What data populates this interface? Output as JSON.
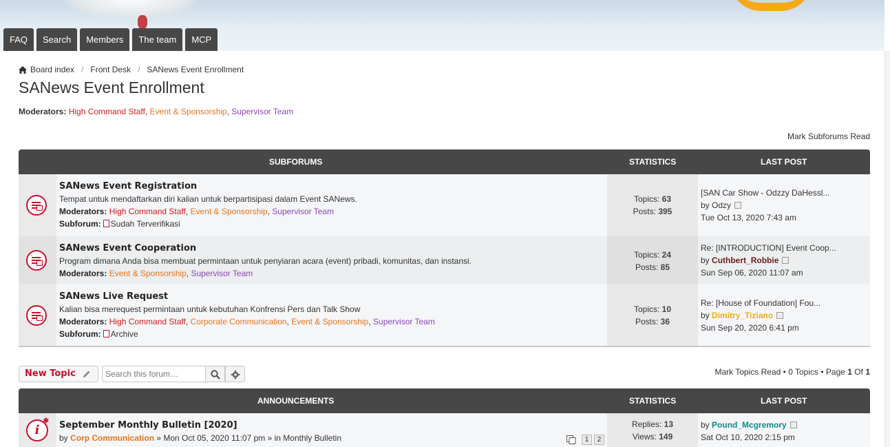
{
  "nav": [
    {
      "label": "FAQ"
    },
    {
      "label": "Search"
    },
    {
      "label": "Members"
    },
    {
      "label": "The team"
    },
    {
      "label": "MCP"
    }
  ],
  "breadcrumb": {
    "home": "Board index",
    "sep": "/",
    "items": [
      "Front Desk",
      "SANews Event Enrollment"
    ]
  },
  "page_title": "SANews Event Enrollment",
  "moderators": {
    "label": "Moderators:",
    "list": [
      "High Command Staff",
      "Event & Sponsorship",
      "Supervisor Team"
    ]
  },
  "mark_subforums_read": "Mark Subforums Read",
  "subforum_table": {
    "head_title": "SUBFORUMS",
    "head_stats": "STATISTICS",
    "head_last": "LAST POST",
    "rows": [
      {
        "title": "SANews Event Registration",
        "desc": "Tempat untuk mendaftarkan diri kalian untuk berpartisipasi dalam Event SANews.",
        "mod_label": "Moderators:",
        "mods": [
          "High Command Staff",
          "Event & Sponsorship",
          "Supervisor Team"
        ],
        "sub_label": "Subforum:",
        "subforum": "Sudah Terverifikasi",
        "topics_label": "Topics:",
        "topics": "63",
        "posts_label": "Posts:",
        "posts": "395",
        "last_title": "[SAN Car Show - Odzzy DaHessl...",
        "last_by": "by",
        "last_user": "Odzy",
        "last_date": "Tue Oct 13, 2020 7:43 am"
      },
      {
        "title": "SANews Event Cooperation",
        "desc": "Program dimana Anda bisa membuat permintaan untuk penyiaran acara (event) pribadi, komunitas, dan instansi.",
        "mod_label": "Moderators:",
        "mods": [
          "Event & Sponsorship",
          "Supervisor Team"
        ],
        "topics_label": "Topics:",
        "topics": "24",
        "posts_label": "Posts:",
        "posts": "85",
        "last_title": "Re: [INTRODUCTION] Event Coop...",
        "last_by": "by",
        "last_user": "Cuthbert_Robbie",
        "last_date": "Sun Sep 06, 2020 11:07 am"
      },
      {
        "title": "SANews Live Request",
        "desc": "Kalian bisa merequest permintaan untuk kebutuhan Konfrensi Pers dan Talk Show",
        "mod_label": "Moderators:",
        "mods": [
          "High Command Staff",
          "Corporate Communication",
          "Event & Sponsorship",
          "Supervisor Team"
        ],
        "sub_label": "Subforum:",
        "subforum": "Archive",
        "topics_label": "Topics:",
        "topics": "10",
        "posts_label": "Posts:",
        "posts": "36",
        "last_title": "Re: [House of Foundation] Fou...",
        "last_by": "by",
        "last_user": "Dimitry_Tiziano",
        "last_date": "Sun Sep 20, 2020 6:41 pm"
      }
    ]
  },
  "toolbar": {
    "new_topic": "New Topic",
    "search_placeholder": "Search this forum…",
    "pagination_mark": "Mark Topics Read",
    "pagination_topics": "0 Topics",
    "pagination_page": "Page",
    "pagination_current": "1",
    "pagination_of": "Of",
    "pagination_total": "1",
    "bullet": "•"
  },
  "announcements": {
    "head_title": "ANNOUNCEMENTS",
    "head_stats": "STATISTICS",
    "head_last": "LAST POST",
    "rows": [
      {
        "title": "September Monthly Bulletin [2020]",
        "by": "by",
        "author": "Corp Communication",
        "posted": "» Mon Oct 05, 2020 11:07 pm » in",
        "forum": "Monthly Bulletin",
        "pages": [
          "1",
          "2"
        ],
        "replies_label": "Replies:",
        "replies": "13",
        "views_label": "Views:",
        "views": "149",
        "last_by": "by",
        "last_user": "Pound_Mcgremory",
        "last_date": "Sat Oct 10, 2020 2:15 pm"
      }
    ]
  },
  "colors": {
    "nav_bg": "#474747",
    "table_head": "#474747",
    "accent_red": "#c8102e",
    "mod_red": "#d61a1a",
    "mod_orange": "#e8741c",
    "mod_purple": "#8a47b5"
  },
  "icons": [
    "home-icon",
    "forum-unread-icon",
    "view-latest-post-icon",
    "subforum-file-icon",
    "pencil-icon",
    "search-icon",
    "gear-icon",
    "announcement-icon",
    "multi-page-icon"
  ]
}
